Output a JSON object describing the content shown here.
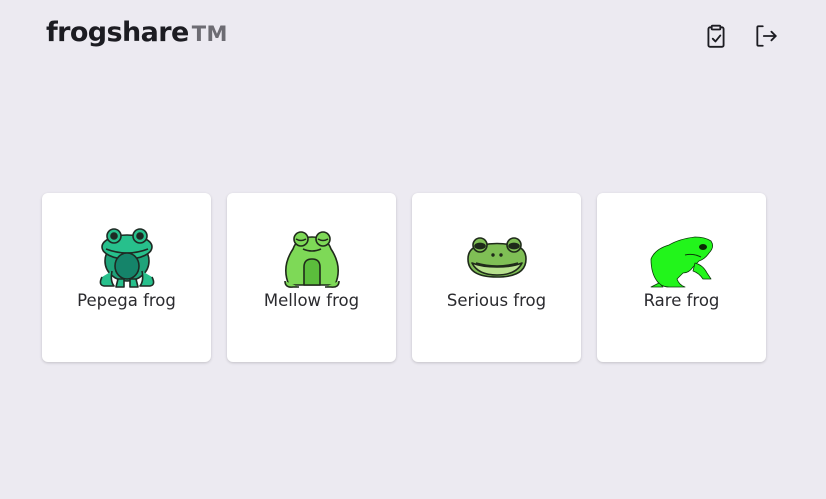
{
  "brand": {
    "name": "frogshare",
    "trademark": "TM"
  },
  "header": {
    "actions": [
      {
        "icon": "clipboard-check-icon"
      },
      {
        "icon": "logout-icon"
      }
    ]
  },
  "frogs": [
    {
      "label": "Pepega frog",
      "icon": "pepega-frog-icon"
    },
    {
      "label": "Mellow frog",
      "icon": "mellow-frog-icon"
    },
    {
      "label": "Serious frog",
      "icon": "serious-frog-icon"
    },
    {
      "label": "Rare frog",
      "icon": "rare-frog-icon"
    }
  ],
  "colors": {
    "background": "#eceaf1",
    "card": "#ffffff",
    "text": "#1c1c22",
    "trademark": "#6d6c73",
    "rare_frog": "#22f51b"
  }
}
